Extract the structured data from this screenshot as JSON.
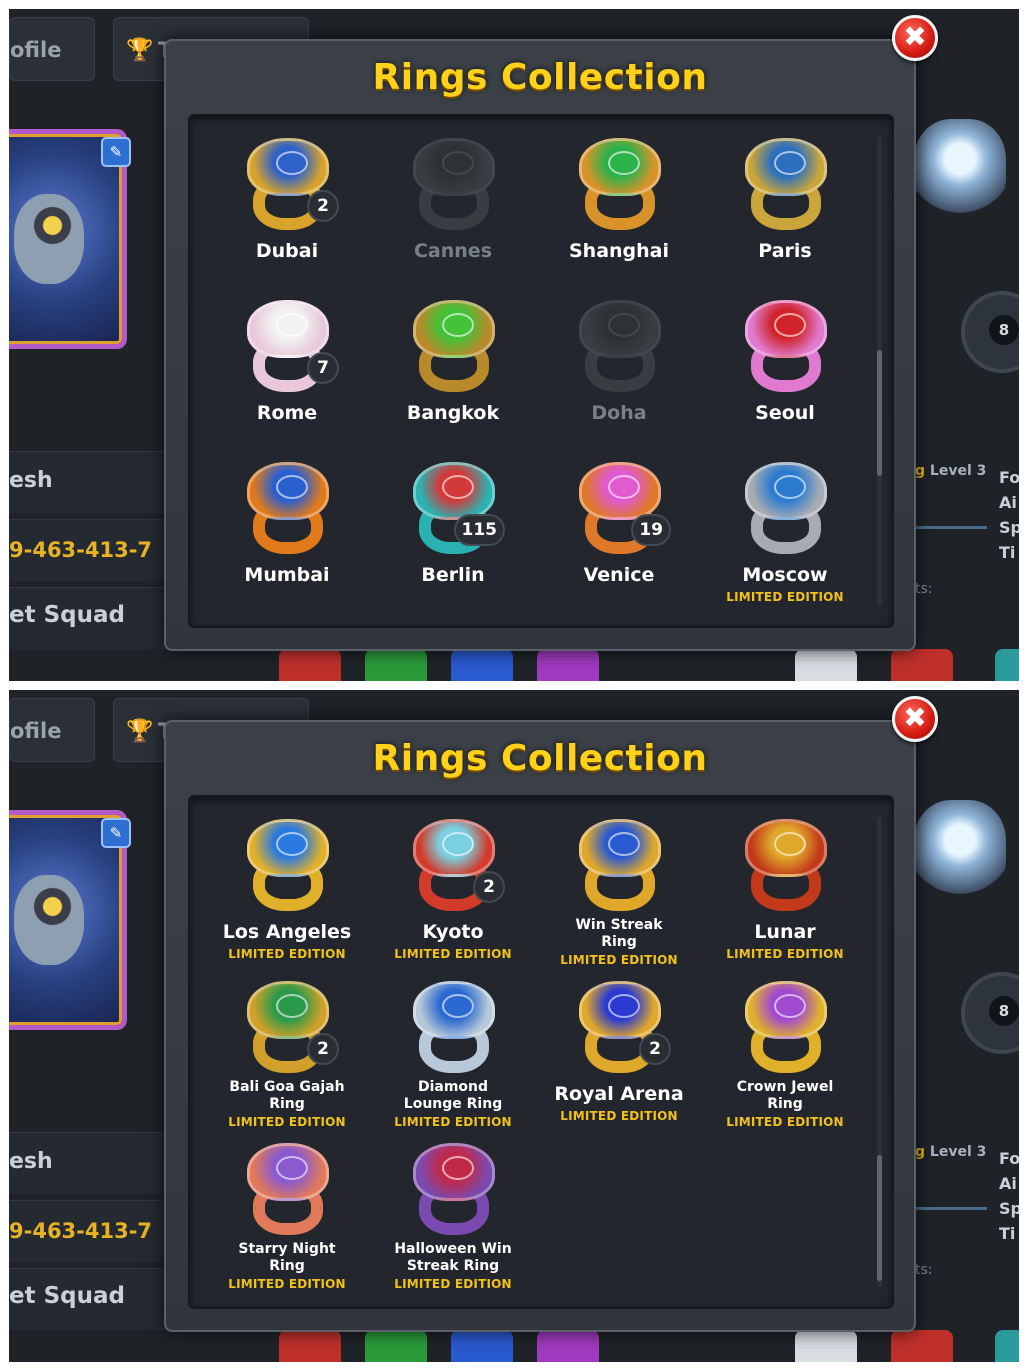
{
  "background": {
    "profile_tab": "ofile",
    "trophy_tab_letter": "T",
    "player_name": "esh",
    "player_id": "9-463-413-7",
    "club": "et Squad",
    "level_prefix": "g",
    "level_text": "Level 3",
    "side_letters": [
      "Fo",
      "Ai",
      "Sp",
      "Ti"
    ],
    "stats_text": "ts:",
    "badge_ball": "8"
  },
  "screenshots": [
    {
      "title": "Rings Collection",
      "close_icon": "✖",
      "rings": [
        {
          "name": "Dubai",
          "count": "2",
          "owned": true,
          "limited": "",
          "colors": [
            "#d8a32a",
            "#2f62c8"
          ]
        },
        {
          "name": "Cannes",
          "count": "",
          "owned": false,
          "limited": "",
          "colors": [
            "#8a8a8a",
            "#555555"
          ]
        },
        {
          "name": "Shanghai",
          "count": "",
          "owned": true,
          "limited": "",
          "colors": [
            "#d9922a",
            "#2bb24a"
          ]
        },
        {
          "name": "Paris",
          "count": "",
          "owned": true,
          "limited": "",
          "colors": [
            "#c9a53a",
            "#2b6fbf"
          ]
        },
        {
          "name": "Rome",
          "count": "7",
          "owned": true,
          "limited": "",
          "colors": [
            "#e9c9d9",
            "#f2f2f2"
          ]
        },
        {
          "name": "Bangkok",
          "count": "",
          "owned": true,
          "limited": "",
          "colors": [
            "#b88a2a",
            "#43c23a"
          ]
        },
        {
          "name": "Doha",
          "count": "",
          "owned": false,
          "limited": "",
          "colors": [
            "#8a8a8a",
            "#555555"
          ]
        },
        {
          "name": "Seoul",
          "count": "",
          "owned": true,
          "limited": "",
          "colors": [
            "#e07ad0",
            "#d0242a"
          ]
        },
        {
          "name": "Mumbai",
          "count": "",
          "owned": true,
          "limited": "",
          "colors": [
            "#e07a1a",
            "#2a5fd0"
          ]
        },
        {
          "name": "Berlin",
          "count": "115",
          "owned": true,
          "limited": "",
          "colors": [
            "#2ab2b2",
            "#d23a3a"
          ]
        },
        {
          "name": "Venice",
          "count": "19",
          "owned": true,
          "limited": "",
          "colors": [
            "#e0782a",
            "#e05ad0"
          ]
        },
        {
          "name": "Moscow",
          "count": "",
          "owned": true,
          "limited": "LIMITED EDITION",
          "colors": [
            "#a8acb2",
            "#2a7ad0"
          ]
        }
      ]
    },
    {
      "title": "Rings Collection",
      "close_icon": "✖",
      "rings": [
        {
          "name": "Los Angeles",
          "count": "",
          "owned": true,
          "limited": "LIMITED EDITION",
          "colors": [
            "#e0b02a",
            "#2a7ae0"
          ]
        },
        {
          "name": "Kyoto",
          "count": "2",
          "owned": true,
          "limited": "LIMITED EDITION",
          "colors": [
            "#d23a2a",
            "#7ad0e0"
          ]
        },
        {
          "name": "Win Streak Ring",
          "count": "",
          "owned": true,
          "limited": "LIMITED EDITION",
          "colors": [
            "#e0a82a",
            "#2a5ad0"
          ]
        },
        {
          "name": "Lunar",
          "count": "",
          "owned": true,
          "limited": "LIMITED EDITION",
          "colors": [
            "#c23a1a",
            "#e0a82a"
          ]
        },
        {
          "name": "Bali Goa Gajah Ring",
          "count": "2",
          "owned": true,
          "limited": "LIMITED EDITION",
          "colors": [
            "#d0a02a",
            "#2a9a4a"
          ]
        },
        {
          "name": "Diamond Lounge Ring",
          "count": "",
          "owned": true,
          "limited": "LIMITED EDITION",
          "colors": [
            "#b8c8d8",
            "#2a6ad0"
          ]
        },
        {
          "name": "Royal Arena",
          "count": "2",
          "owned": true,
          "limited": "LIMITED EDITION",
          "colors": [
            "#e0a82a",
            "#2a3ad0"
          ]
        },
        {
          "name": "Crown Jewel Ring",
          "count": "",
          "owned": true,
          "limited": "LIMITED EDITION",
          "colors": [
            "#e0b02a",
            "#a04ad0"
          ]
        },
        {
          "name": "Starry Night Ring",
          "count": "",
          "owned": true,
          "limited": "LIMITED EDITION",
          "colors": [
            "#e07a5a",
            "#8a5ad0"
          ]
        },
        {
          "name": "Halloween Win Streak Ring",
          "count": "",
          "owned": true,
          "limited": "LIMITED EDITION",
          "colors": [
            "#7a4ab0",
            "#c02a4a"
          ]
        }
      ]
    }
  ]
}
